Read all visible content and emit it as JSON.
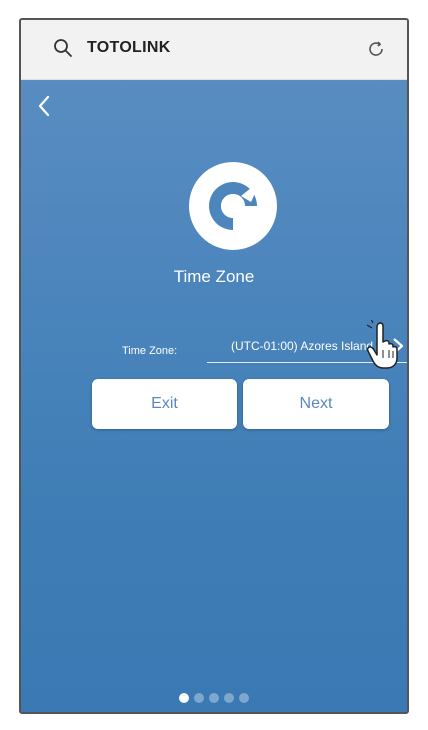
{
  "search_bar": {
    "text": "TOTOLINK",
    "search_icon": "search-icon",
    "reload_icon": "reload-icon"
  },
  "nav": {
    "back_icon": "chevron-left-icon"
  },
  "logo": {
    "icon": "totolink-logo-icon"
  },
  "title": "Time Zone",
  "time_zone": {
    "label": "Time Zone:",
    "value": "(UTC-01:00) Azores Island",
    "arrow_icon": "chevron-right-icon"
  },
  "buttons": {
    "exit_label": "Exit",
    "next_label": "Next"
  },
  "pagination": {
    "total": 5,
    "active_index": 0
  },
  "colors": {
    "background": "#4d86bd",
    "accent": "#5a88bd",
    "search_bar": "#f2f2f2"
  }
}
